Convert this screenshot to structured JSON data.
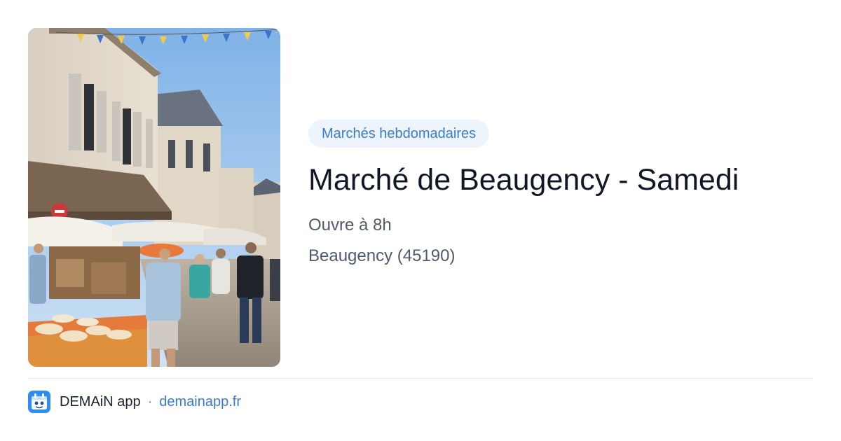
{
  "event": {
    "category": "Marchés hebdomadaires",
    "title": "Marché de Beaugency - Samedi",
    "hours": "Ouvre à 8h",
    "location": "Beaugency (45190)"
  },
  "photo": {
    "subject": "market-street-photo"
  },
  "footer": {
    "app_name": "DEMAiN app",
    "separator": "·",
    "domain": "demainapp.fr"
  },
  "colors": {
    "accent": "#3a7bd0",
    "tag_bg": "#eef4fb",
    "title": "#101828",
    "meta": "#4f5b6d",
    "app_icon": "#2f8df2"
  }
}
